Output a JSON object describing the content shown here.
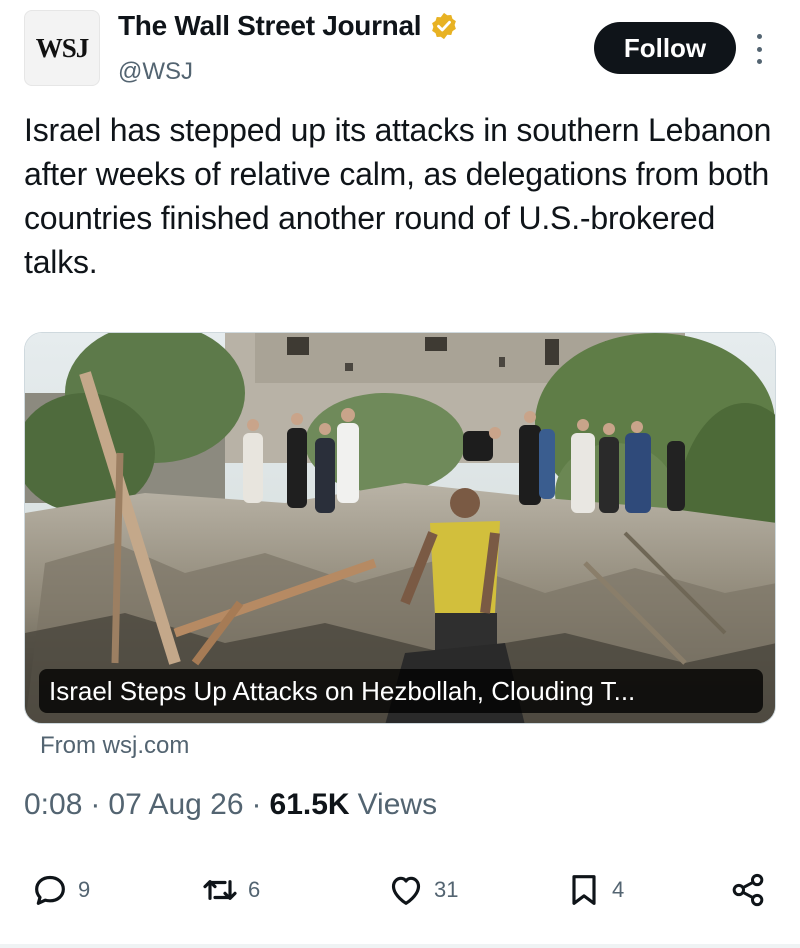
{
  "account": {
    "avatar_text": "WSJ",
    "display_name": "The Wall Street Journal",
    "handle": "@WSJ",
    "verified_badge_color": "#e8b223"
  },
  "follow_label": "Follow",
  "tweet": {
    "text": "Israel has stepped up its attacks in southern Lebanon after weeks of relative calm, as delegations from both countries finished another round of U.S.-brokered talks."
  },
  "card": {
    "title": "Israel Steps Up Attacks on Hezbollah, Clouding T...",
    "source": "From wsj.com"
  },
  "meta": {
    "time": "0:08",
    "date": "07 Aug 26",
    "views_count": "61.5K",
    "views_label": "Views"
  },
  "actions": {
    "reply_count": "9",
    "retweet_count": "6",
    "like_count": "31",
    "bookmark_count": "4"
  },
  "icons": {
    "reply": "speech-bubble-icon",
    "retweet": "retweet-arrows-icon",
    "like": "heart-icon",
    "bookmark": "bookmark-icon",
    "share": "share-nodes-icon",
    "more": "vertical-dots-icon",
    "verified": "verified-badge-icon"
  }
}
